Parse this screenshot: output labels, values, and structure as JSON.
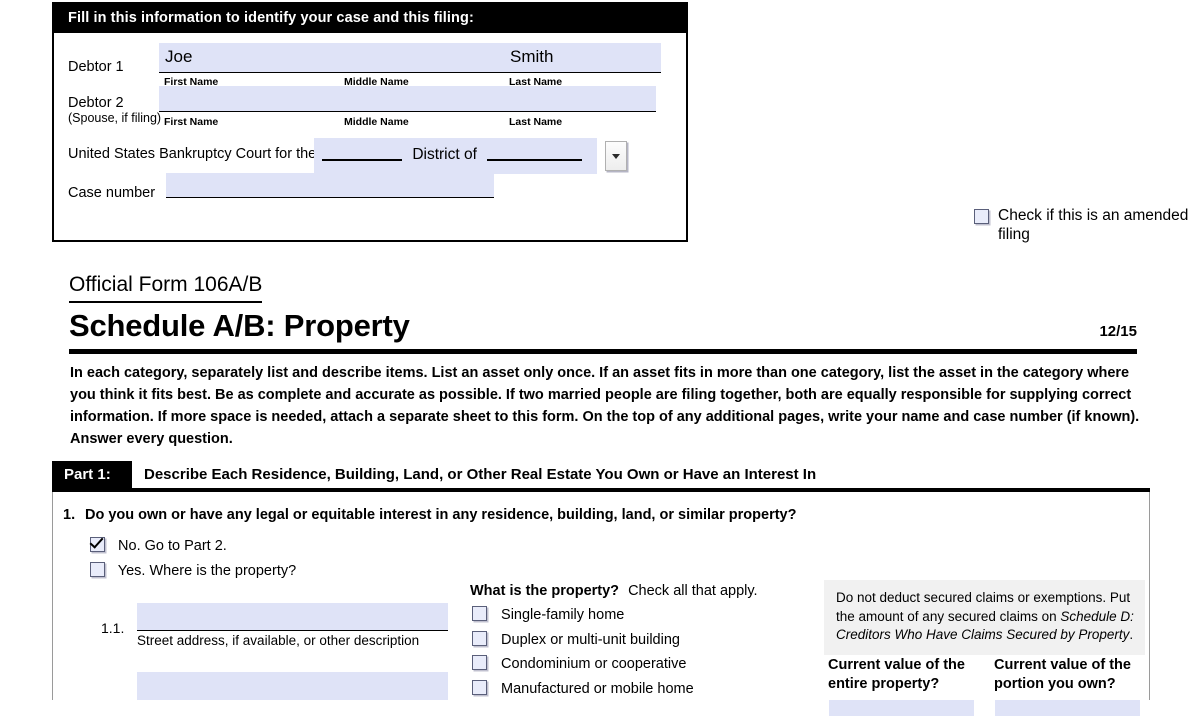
{
  "case_info": {
    "header": "Fill in this information to identify your case and this filing:",
    "debtor1_label": "Debtor 1",
    "debtor1_first": "Joe",
    "debtor1_middle": "",
    "debtor1_last": "Smith",
    "debtor2_label": "Debtor 2",
    "debtor2_sublabel": "(Spouse, if filing)",
    "debtor2_first": "",
    "debtor2_middle": "",
    "debtor2_last": "",
    "caption_first": "First Name",
    "caption_middle": "Middle Name",
    "caption_last": "Last Name",
    "court_label": "United States Bankruptcy Court for the:",
    "court_district_word": "District of",
    "court_district_value": "",
    "court_state_value": "",
    "case_number_label": "Case number",
    "case_number_value": "",
    "dropdown_icon": "chevron-down-icon"
  },
  "amended": {
    "label": "Check if this is an amended filing",
    "checked": false
  },
  "form": {
    "number": "Official Form 106A/B",
    "title": "Schedule A/B: Property",
    "revision": "12/15",
    "instructions": "In each category, separately list and describe items. List an asset only once.  If an asset fits in more than one category, list the asset in the category where you think it fits best.  Be as complete and accurate as possible. If two married people are filing together, both are equally responsible for supplying correct information. If more space is needed, attach a separate sheet to this form. On the top of any additional pages, write your name and case number (if known). Answer every question."
  },
  "part1": {
    "tag": "Part 1:",
    "title": "Describe Each Residence, Building, Land, or Other Real Estate You Own or Have an Interest In",
    "question_number": "1.",
    "question": "Do you own or have any legal or equitable interest in any residence, building, land, or similar property?",
    "option_no": "No. Go to Part 2.",
    "option_no_checked": true,
    "option_yes": "Yes. Where is the property?",
    "option_yes_checked": false,
    "item_number": "1.1.",
    "street_caption": "Street address, if available, or other description",
    "street_value": "",
    "street_line2_value": "",
    "property_question_bold": "What is the property?",
    "property_question_rest": "Check all that apply.",
    "property_types": [
      {
        "label": "Single-family home",
        "checked": false
      },
      {
        "label": "Duplex or multi-unit building",
        "checked": false
      },
      {
        "label": "Condominium or cooperative",
        "checked": false
      },
      {
        "label": "Manufactured or mobile home",
        "checked": false
      }
    ],
    "note_part1": "Do not deduct secured claims or exemptions. Put the amount of any secured claims on ",
    "note_italic": "Schedule D: Creditors Who Have Claims Secured by Property",
    "note_end": ".",
    "value_head_entire": "Current value of the entire property?",
    "value_head_portion": "Current value of the portion you own?",
    "value_entire": "",
    "value_portion": ""
  },
  "colors": {
    "field_fill": "#dfe3f7",
    "note_bg": "#f1f1f1",
    "bar_black": "#000000",
    "frame_gray": "#9a9a9a"
  }
}
